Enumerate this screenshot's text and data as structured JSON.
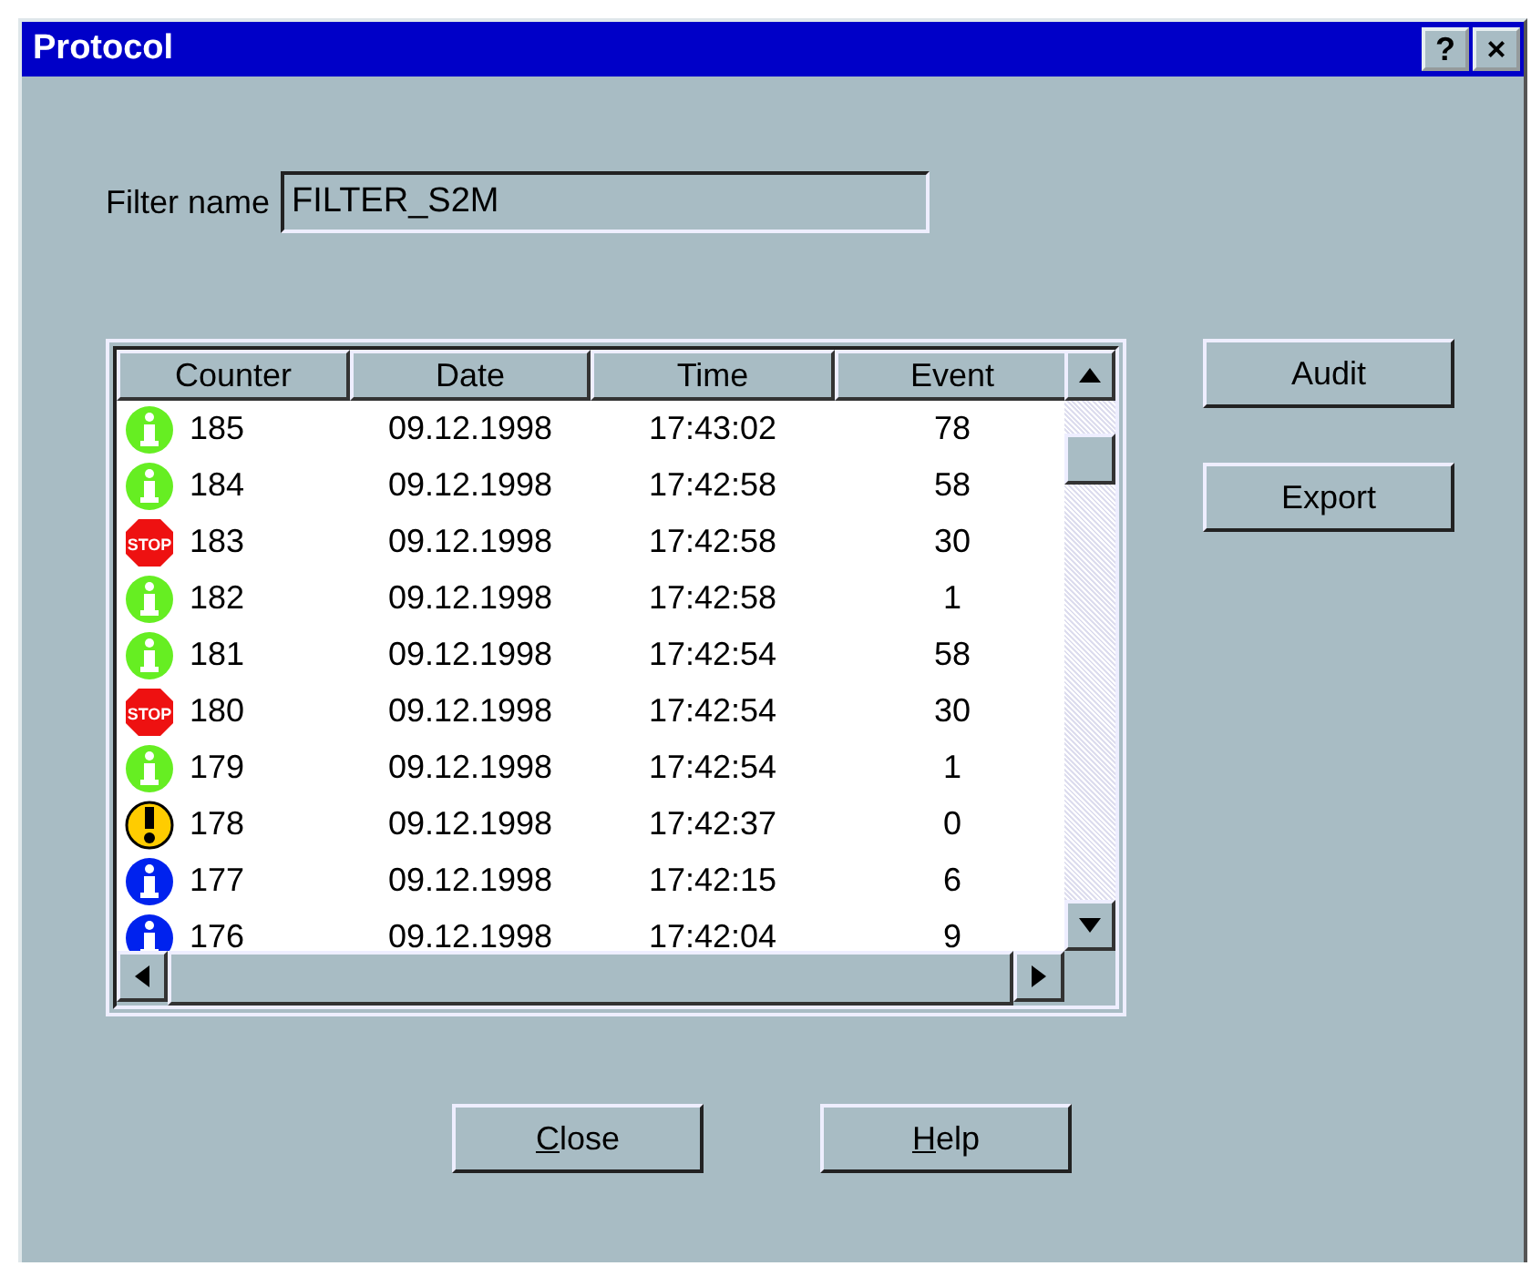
{
  "window": {
    "title": "Protocol",
    "title_buttons": [
      "?",
      "×"
    ]
  },
  "filter": {
    "label": "Filter name",
    "value": "FILTER_S2M"
  },
  "table": {
    "columns": [
      "Counter",
      "Date",
      "Time",
      "Event"
    ],
    "rows": [
      {
        "kind": "info",
        "color": "#66ee22",
        "counter": "185",
        "date": "09.12.1998",
        "time": "17:43:02",
        "event": "78"
      },
      {
        "kind": "info",
        "color": "#66ee22",
        "counter": "184",
        "date": "09.12.1998",
        "time": "17:42:58",
        "event": "58"
      },
      {
        "kind": "stop",
        "color": "#ee1111",
        "icon_label": "STOP",
        "counter": "183",
        "date": "09.12.1998",
        "time": "17:42:58",
        "event": "30"
      },
      {
        "kind": "info",
        "color": "#66ee22",
        "counter": "182",
        "date": "09.12.1998",
        "time": "17:42:58",
        "event": "1"
      },
      {
        "kind": "info",
        "color": "#66ee22",
        "counter": "181",
        "date": "09.12.1998",
        "time": "17:42:54",
        "event": "58"
      },
      {
        "kind": "stop",
        "color": "#ee1111",
        "icon_label": "STOP",
        "counter": "180",
        "date": "09.12.1998",
        "time": "17:42:54",
        "event": "30"
      },
      {
        "kind": "info",
        "color": "#66ee22",
        "counter": "179",
        "date": "09.12.1998",
        "time": "17:42:54",
        "event": "1"
      },
      {
        "kind": "warning",
        "color": "#ffcc00",
        "counter": "178",
        "date": "09.12.1998",
        "time": "17:42:37",
        "event": "0"
      },
      {
        "kind": "info",
        "color": "#0022ee",
        "counter": "177",
        "date": "09.12.1998",
        "time": "17:42:15",
        "event": "6"
      },
      {
        "kind": "info",
        "color": "#0022ee",
        "counter": "176",
        "date": "09.12.1998",
        "time": "17:42:04",
        "event": "9"
      }
    ]
  },
  "side_buttons": [
    {
      "label": "Audit",
      "underline_first": false
    },
    {
      "label": "Export",
      "underline_first": false
    }
  ],
  "bottom_buttons": [
    {
      "label": "Close",
      "underline_first": true
    },
    {
      "label": "Help",
      "underline_first": true
    }
  ]
}
